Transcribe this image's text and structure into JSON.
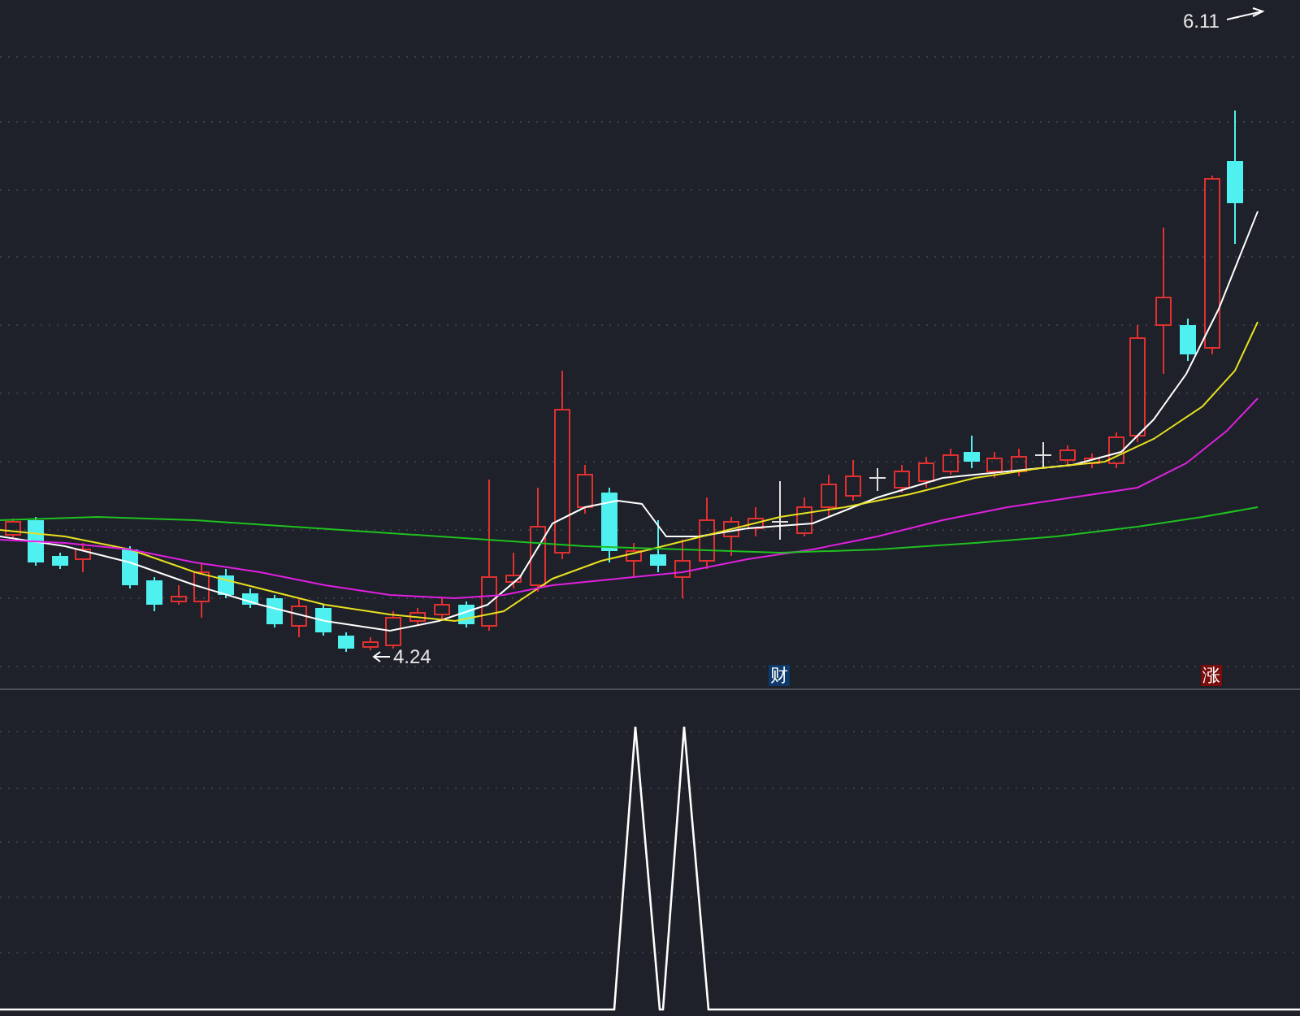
{
  "price_panel": {
    "high_marker": {
      "label": "6.11"
    },
    "low_marker": {
      "label": "4.24"
    },
    "event_tags": [
      {
        "label": "财",
        "kind": "finance"
      },
      {
        "label": "涨",
        "kind": "rise"
      }
    ]
  }
}
